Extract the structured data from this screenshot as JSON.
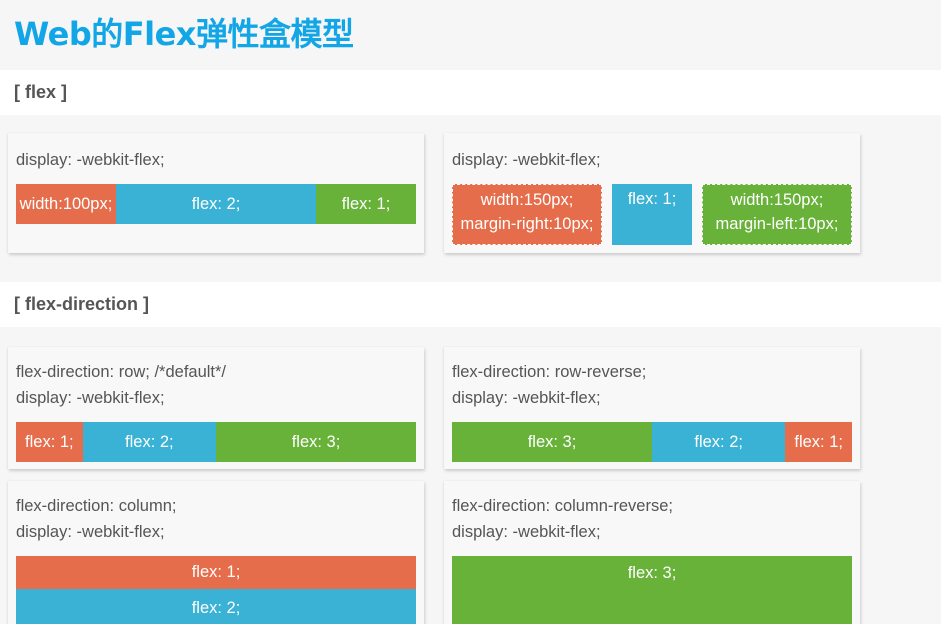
{
  "page": {
    "title": "Web的Flex弹性盒模型"
  },
  "sections": {
    "flex": {
      "title": "[ flex ]"
    },
    "flex_direction": {
      "title": "[ flex-direction ]"
    }
  },
  "cards": {
    "flex_basic": {
      "code": [
        "display: -webkit-flex;"
      ],
      "items": [
        "width:100px;",
        "flex: 2;",
        "flex: 1;"
      ]
    },
    "flex_margin": {
      "code": [
        "display: -webkit-flex;"
      ],
      "items": [
        {
          "line1": "width:150px;",
          "line2": "margin-right:10px;"
        },
        {
          "line1": "flex: 1;"
        },
        {
          "line1": "width:150px;",
          "line2": "margin-left:10px;"
        }
      ]
    },
    "row": {
      "code": [
        "flex-direction: row; /*default*/",
        "display: -webkit-flex;"
      ],
      "items": [
        "flex: 1;",
        "flex: 2;",
        "flex: 3;"
      ]
    },
    "row_reverse": {
      "code": [
        "flex-direction: row-reverse;",
        "display: -webkit-flex;"
      ],
      "items": [
        "flex: 3;",
        "flex: 2;",
        "flex: 1;"
      ]
    },
    "column": {
      "code": [
        "flex-direction: column;",
        "display: -webkit-flex;"
      ],
      "items": [
        "flex: 1;",
        "flex: 2;"
      ]
    },
    "column_reverse": {
      "code": [
        "flex-direction: column-reverse;",
        "display: -webkit-flex;"
      ],
      "items": [
        "flex: 3;"
      ]
    }
  },
  "colors": {
    "title": "#13a6e6",
    "red": "#e56d4b",
    "blue": "#39b2d5",
    "green": "#68b23a"
  }
}
